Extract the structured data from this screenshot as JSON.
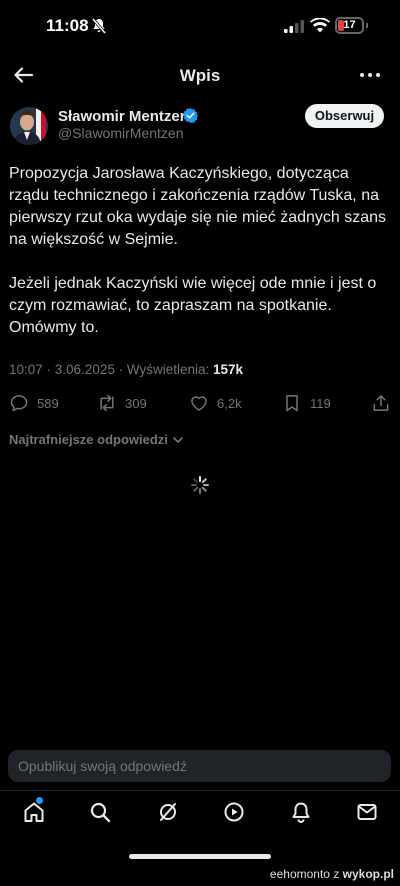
{
  "status_bar": {
    "time": "11:08",
    "battery": "17"
  },
  "header": {
    "title": "Wpis"
  },
  "author": {
    "name": "Sławomir Mentzen",
    "handle": "@SlawomirMentzen",
    "follow_label": "Obserwuj"
  },
  "tweet": {
    "paragraph_1": "Propozycja Jarosława Kaczyńskiego, dotycząca rządu technicznego i zakończenia rządów Tuska, na pierwszy rzut oka wydaje się nie mieć żadnych szans na większość w Sejmie.",
    "paragraph_2": "Jeżeli jednak Kaczyński wie więcej ode mnie i jest o czym rozmawiać, to zapraszam na spotkanie. Omówmy to.",
    "meta": "10:07 · 3.06.2025 · Wyświetlenia: ",
    "views": "157k"
  },
  "actions": {
    "replies": "589",
    "reposts": "309",
    "likes": "6,2k",
    "bookmarks": "119"
  },
  "replies_sort": {
    "label": "Najtrafniejsze odpowiedzi"
  },
  "reply_bar": {
    "placeholder": "Opublikuj swoją odpowiedź"
  },
  "watermark": {
    "author": "eehomonto",
    "connector": "z",
    "site": "wykop.pl"
  },
  "colors": {
    "accent": "#1d9bf0",
    "background": "#000000",
    "battery": "#e0433e"
  },
  "icons": [
    "bell-off-icon",
    "signal-icon",
    "wifi-icon",
    "back-arrow-icon",
    "more-icon",
    "verified-icon",
    "reply-icon",
    "repost-icon",
    "like-icon",
    "bookmark-icon",
    "share-icon",
    "chevron-down-icon",
    "spinner-icon",
    "home-icon",
    "search-icon",
    "grok-icon",
    "video-icon",
    "notifications-icon",
    "messages-icon"
  ]
}
